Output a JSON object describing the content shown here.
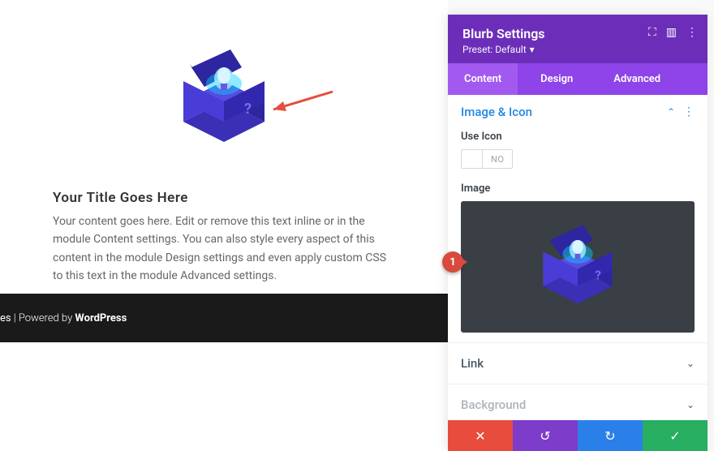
{
  "preview": {
    "title": "Your Title Goes Here",
    "content": "Your content goes here. Edit or remove this text inline or in the module Content settings. You can also style every aspect of this content in the module Design settings and even apply custom CSS to this text in the module Advanced settings."
  },
  "footer": {
    "prefix": "es",
    "separator": " | Powered by ",
    "brand": "WordPress"
  },
  "panel": {
    "title": "Blurb Settings",
    "preset_label": "Preset: Default"
  },
  "tabs": {
    "content": "Content",
    "design": "Design",
    "advanced": "Advanced"
  },
  "sections": {
    "image_icon": "Image & Icon",
    "link": "Link",
    "background": "Background"
  },
  "fields": {
    "use_icon": "Use Icon",
    "use_icon_value": "NO",
    "image": "Image"
  },
  "callout": "1"
}
